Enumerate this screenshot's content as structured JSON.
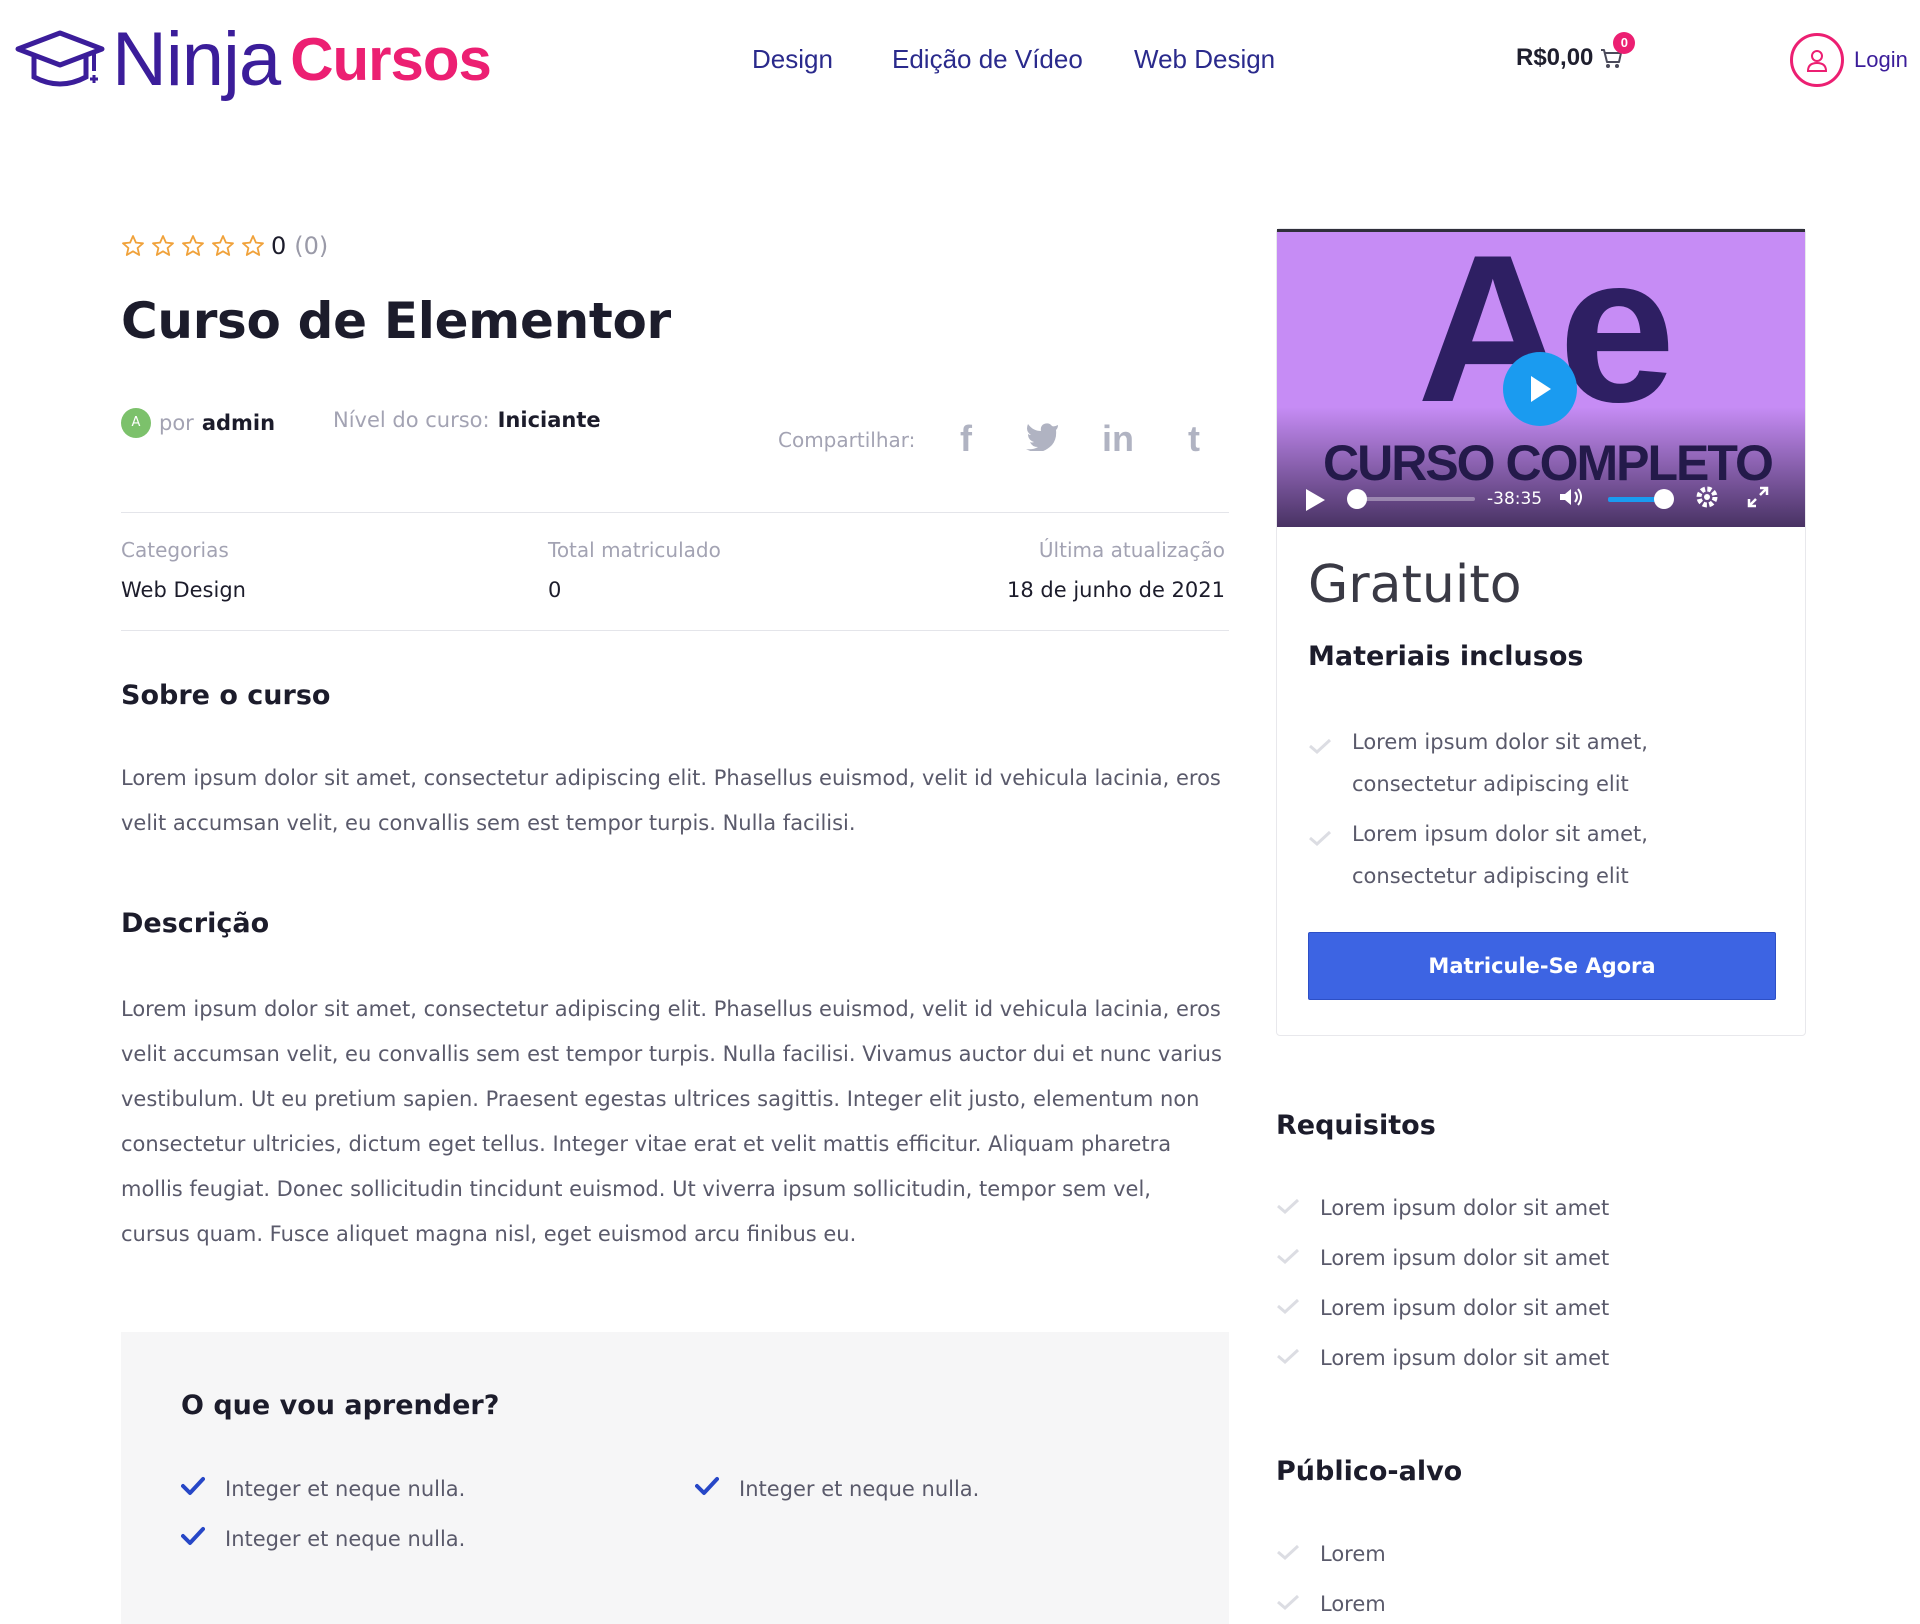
{
  "header": {
    "logo": {
      "ninja": "Ninja",
      "cursos": "Cursos"
    },
    "nav": [
      {
        "label": "Design"
      },
      {
        "label": "Edição de Vídeo"
      },
      {
        "label": "Web Design"
      }
    ],
    "cart": {
      "total": "R$0,00",
      "count": "0"
    },
    "login": {
      "label": "Login"
    }
  },
  "course": {
    "rating": {
      "value": "0",
      "count": "(0)",
      "stars_filled": 0,
      "stars_total": 5
    },
    "title": "Curso de Elementor",
    "author": {
      "avatar_letter": "A",
      "by": "por",
      "name": "admin"
    },
    "level": {
      "label": "Nível do curso:",
      "value": "Iniciante"
    },
    "share": {
      "label": "Compartilhar:",
      "icons": [
        "facebook-icon",
        "twitter-icon",
        "linkedin-icon",
        "tumblr-icon"
      ]
    },
    "info": [
      {
        "label": "Categorias",
        "value": "Web Design"
      },
      {
        "label": "Total matriculado",
        "value": "0"
      },
      {
        "label": "Última atualização",
        "value": "18 de junho de 2021"
      }
    ]
  },
  "about": {
    "heading": "Sobre o curso",
    "lines": [
      "Lorem ipsum dolor sit amet, consectetur adipiscing elit. Phasellus euismod, velit id vehicula lacinia, eros",
      "velit accumsan velit, eu convallis sem est tempor turpis. Nulla facilisi."
    ]
  },
  "description": {
    "heading": "Descrição",
    "lines": [
      "Lorem ipsum dolor sit amet, consectetur adipiscing elit. Phasellus euismod, velit id vehicula lacinia, eros",
      "velit accumsan velit, eu convallis sem est tempor turpis. Nulla facilisi. Vivamus auctor dui et nunc varius",
      "vestibulum. Ut eu pretium sapien. Praesent egestas ultrices sagittis. Integer elit justo, elementum non",
      "consectetur ultricies, dictum eget tellus. Integer vitae erat et velit mattis efficitur. Aliquam pharetra",
      "mollis feugiat. Donec sollicitudin tincidunt euismod. Ut viverra ipsum sollicitudin, tempor sem vel,",
      "cursus quam. Fusce aliquet magna nisl, eget euismod arcu finibus eu."
    ]
  },
  "learn": {
    "heading": "O que vou aprender?",
    "items": [
      "Integer et neque nulla.",
      "Integer et neque nulla.",
      "Integer et neque nulla."
    ]
  },
  "sidebar": {
    "video": {
      "thumb_logo": "Ae",
      "thumb_caption": "CURSO COMPLETO",
      "time_remaining": "-38:35",
      "progress": 0,
      "volume": 1.0
    },
    "price": "Gratuito",
    "materials": {
      "heading": "Materiais inclusos",
      "items": [
        {
          "line1": "Lorem ipsum dolor sit amet,",
          "line2": "consectetur adipiscing elit"
        },
        {
          "line1": "Lorem ipsum dolor sit amet,",
          "line2": "consectetur adipiscing elit"
        }
      ]
    },
    "enroll_label": "Matricule-Se Agora",
    "requirements": {
      "heading": "Requisitos",
      "items": [
        "Lorem ipsum dolor sit amet",
        "Lorem ipsum dolor sit amet",
        "Lorem ipsum dolor sit amet",
        "Lorem ipsum dolor sit amet"
      ]
    },
    "audience": {
      "heading": "Público-alvo",
      "items": [
        "Lorem",
        "Lorem"
      ]
    }
  },
  "colors": {
    "brand_purple": "#3b1d9a",
    "brand_pink": "#ec1f72",
    "nav_blue": "#2a2a8c",
    "enroll_blue": "#3d64e3",
    "check_blue": "#2747c7",
    "video_bg": "#c68cf5",
    "play_blue": "#1a9bf0"
  }
}
